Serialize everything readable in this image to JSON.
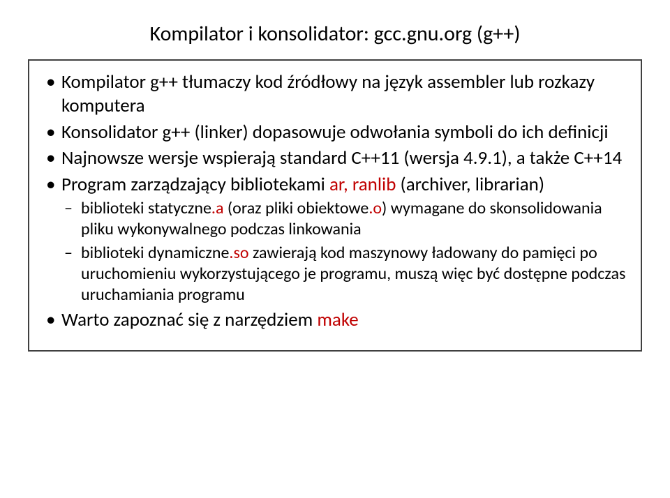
{
  "title": "Kompilator i konsolidator: gcc.gnu.org (g++)",
  "bullets": {
    "b1": "Kompilator g++ tłumaczy kod źródłowy na język assembler lub rozkazy komputera",
    "b2": "Konsolidator g++ (linker) dopasowuje odwołania symboli do ich definicji",
    "b3": "Najnowsze wersje wspierają standard C++11 (wersja 4.9.1), a także C++14",
    "b4_pre": "Program zarządzający bibliotekami ",
    "b4_red": "ar, ranlib",
    "b4_post": " (archiver, librarian)",
    "b4_sub1_pre": "biblioteki statyczne",
    "b4_sub1_a": ".a",
    "b4_sub1_mid": " (oraz pliki obiektowe",
    "b4_sub1_o": ".o",
    "b4_sub1_post": ") wymagane do skonsolidowania pliku wykonywalnego podczas linkowania",
    "b4_sub2_pre": "biblioteki dynamiczne",
    "b4_sub2_so": ".so",
    "b4_sub2_post": " zawierają kod maszynowy ładowany do pamięci po uruchomieniu wykorzystującego je programu, muszą więc być dostępne podczas uruchamiania programu",
    "b5_pre": "Warto zapoznać się z narzędziem ",
    "b5_red": "make"
  }
}
